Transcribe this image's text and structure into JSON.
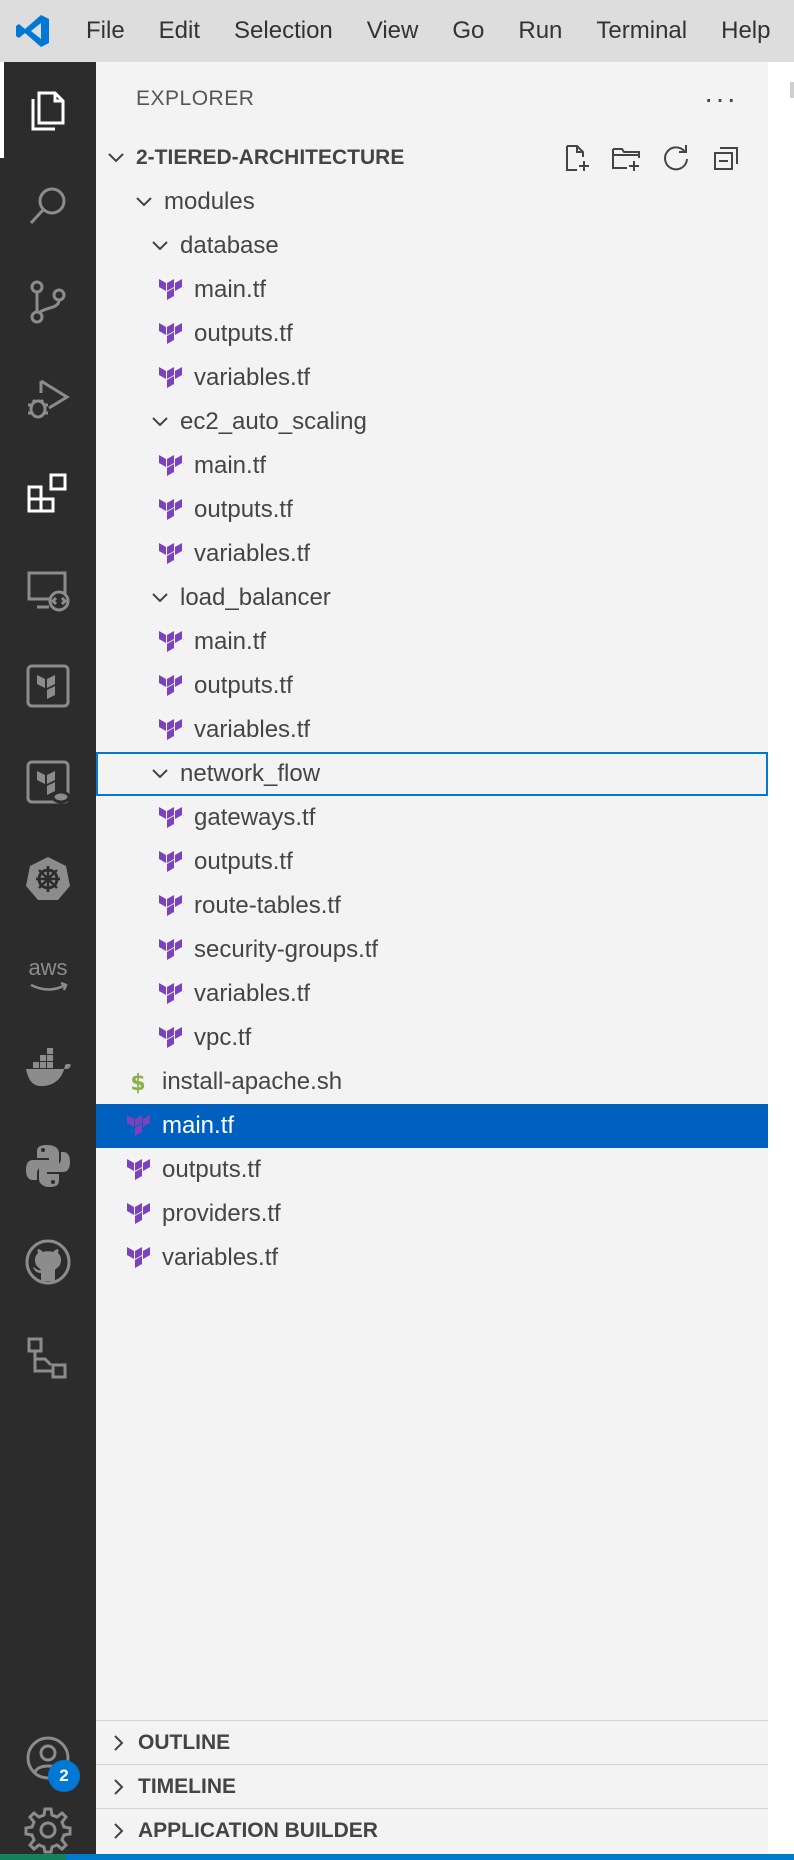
{
  "menubar": {
    "items": [
      "File",
      "Edit",
      "Selection",
      "View",
      "Go",
      "Run",
      "Terminal",
      "Help"
    ]
  },
  "activity_bar": {
    "icons": [
      "files-icon",
      "search-icon",
      "source-control-icon",
      "run-debug-icon",
      "extensions-icon",
      "remote-explorer-icon",
      "terraform-icon",
      "terraform-cloud-icon",
      "kubernetes-icon",
      "aws-icon",
      "docker-icon",
      "python-icon",
      "github-icon",
      "application-builder-icon",
      "accounts-icon",
      "settings-gear-icon"
    ],
    "accounts_badge": "2",
    "aws_label": "aws"
  },
  "explorer": {
    "title": "EXPLORER",
    "more": "···",
    "root": "2-TIERED-ARCHITECTURE",
    "tree": [
      {
        "label": "modules",
        "type": "folder",
        "depth": 1
      },
      {
        "label": "database",
        "type": "folder",
        "depth": 2
      },
      {
        "label": "main.tf",
        "type": "tf",
        "depth": 3
      },
      {
        "label": "outputs.tf",
        "type": "tf",
        "depth": 3
      },
      {
        "label": "variables.tf",
        "type": "tf",
        "depth": 3
      },
      {
        "label": "ec2_auto_scaling",
        "type": "folder",
        "depth": 2
      },
      {
        "label": "main.tf",
        "type": "tf",
        "depth": 3
      },
      {
        "label": "outputs.tf",
        "type": "tf",
        "depth": 3
      },
      {
        "label": "variables.tf",
        "type": "tf",
        "depth": 3
      },
      {
        "label": "load_balancer",
        "type": "folder",
        "depth": 2
      },
      {
        "label": "main.tf",
        "type": "tf",
        "depth": 3
      },
      {
        "label": "outputs.tf",
        "type": "tf",
        "depth": 3
      },
      {
        "label": "variables.tf",
        "type": "tf",
        "depth": 3
      },
      {
        "label": "network_flow",
        "type": "folder",
        "depth": 2,
        "focused": true
      },
      {
        "label": "gateways.tf",
        "type": "tf",
        "depth": 3
      },
      {
        "label": "outputs.tf",
        "type": "tf",
        "depth": 3
      },
      {
        "label": "route-tables.tf",
        "type": "tf",
        "depth": 3
      },
      {
        "label": "security-groups.tf",
        "type": "tf",
        "depth": 3
      },
      {
        "label": "variables.tf",
        "type": "tf",
        "depth": 3
      },
      {
        "label": "vpc.tf",
        "type": "tf",
        "depth": 3
      },
      {
        "label": "install-apache.sh",
        "type": "sh",
        "depth": 1
      },
      {
        "label": "main.tf",
        "type": "tf",
        "depth": 1,
        "selected": true
      },
      {
        "label": "outputs.tf",
        "type": "tf",
        "depth": 1
      },
      {
        "label": "providers.tf",
        "type": "tf",
        "depth": 1
      },
      {
        "label": "variables.tf",
        "type": "tf",
        "depth": 1
      }
    ]
  },
  "panels": {
    "outline": "OUTLINE",
    "timeline": "TIMELINE",
    "app_builder": "APPLICATION BUILDER"
  },
  "colors": {
    "terraform": "#7b42bc",
    "shell": "#89b04a",
    "selection": "#0060c0",
    "focus_border": "#0078d4",
    "activity_bar": "#2c2c2c",
    "vscode_logo": "#0078d4"
  }
}
